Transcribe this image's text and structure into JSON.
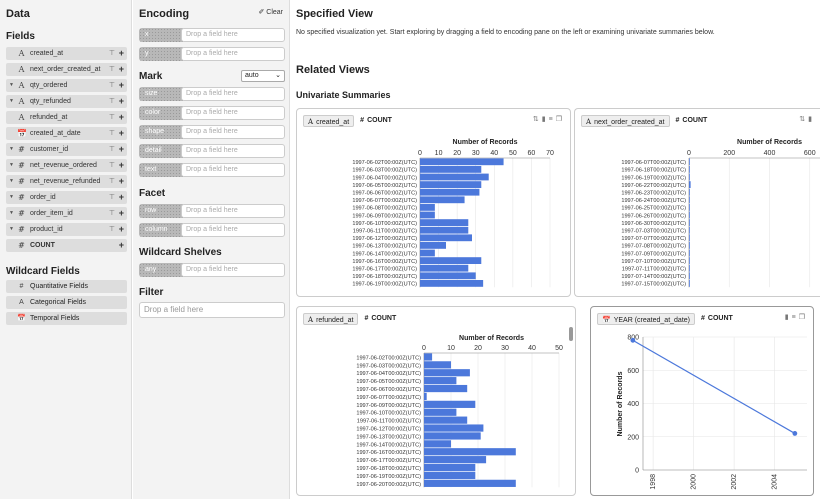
{
  "data_pane": {
    "title": "Data",
    "fields_title": "Fields",
    "fields": [
      {
        "name": "created_at",
        "type": "A",
        "caret": ""
      },
      {
        "name": "next_order_created_at",
        "type": "A",
        "caret": ""
      },
      {
        "name": "qty_ordered",
        "type": "A",
        "caret": "▼"
      },
      {
        "name": "qty_refunded",
        "type": "A",
        "caret": "▼"
      },
      {
        "name": "refunded_at",
        "type": "A",
        "caret": ""
      },
      {
        "name": "created_at_date",
        "type": "📅",
        "caret": ""
      },
      {
        "name": "customer_id",
        "type": "#",
        "caret": "▼"
      },
      {
        "name": "net_revenue_ordered",
        "type": "#",
        "caret": "▼"
      },
      {
        "name": "net_revenue_refunded",
        "type": "#",
        "caret": "▼"
      },
      {
        "name": "order_id",
        "type": "#",
        "caret": "▼"
      },
      {
        "name": "order_item_id",
        "type": "#",
        "caret": "▼"
      },
      {
        "name": "product_id",
        "type": "#",
        "caret": "▼"
      },
      {
        "name": "COUNT",
        "type": "#",
        "caret": ""
      }
    ],
    "wildcard_title": "Wildcard Fields",
    "wildcards": [
      {
        "name": "Quantitative Fields",
        "type": "#"
      },
      {
        "name": "Categorical Fields",
        "type": "A"
      },
      {
        "name": "Temporal Fields",
        "type": "📅"
      }
    ]
  },
  "encoding_pane": {
    "title": "Encoding",
    "clear_label": "Clear",
    "drop_placeholder": "Drop a field here",
    "position_shelves": [
      "x",
      "y"
    ],
    "mark_title": "Mark",
    "mark_value": "auto",
    "mark_shelves": [
      "size",
      "color",
      "shape",
      "detail",
      "text"
    ],
    "facet_title": "Facet",
    "facet_shelves": [
      "row",
      "column"
    ],
    "wildcard_title": "Wildcard Shelves",
    "wildcard_shelves": [
      "any"
    ],
    "filter_title": "Filter",
    "filter_placeholder": "Drop a field here"
  },
  "main": {
    "specified_title": "Specified View",
    "specified_info": "No specified visualization yet. Start exploring by dragging a field to encoding pane on the left or examining univariate summaries below.",
    "related_title": "Related Views",
    "univariate_title": "Univariate Summaries"
  },
  "cards": [
    {
      "field_type": "A",
      "field": "created_at",
      "count_label": "COUNT"
    },
    {
      "field_type": "A",
      "field": "next_order_created_at",
      "count_label": "COUNT"
    },
    {
      "field_type": "A",
      "field": "refunded_at",
      "count_label": "COUNT"
    },
    {
      "field_type": "📅",
      "field": "YEAR (created_at_date)",
      "count_label": "COUNT"
    }
  ],
  "chart_data": [
    {
      "type": "bar",
      "orientation": "horizontal",
      "title": "Number of Records",
      "xlim": [
        0,
        70
      ],
      "xticks": [
        0,
        10,
        20,
        30,
        40,
        50,
        60,
        70
      ],
      "bar_color": "#4c78db",
      "categories": [
        "1997-06-02T00:00Z(UTC)",
        "1997-06-03T00:00Z(UTC)",
        "1997-06-04T00:00Z(UTC)",
        "1997-06-05T00:00Z(UTC)",
        "1997-06-06T00:00Z(UTC)",
        "1997-06-07T00:00Z(UTC)",
        "1997-06-08T00:00Z(UTC)",
        "1997-06-09T00:00Z(UTC)",
        "1997-06-10T00:00Z(UTC)",
        "1997-06-11T00:00Z(UTC)",
        "1997-06-12T00:00Z(UTC)",
        "1997-06-13T00:00Z(UTC)",
        "1997-06-14T00:00Z(UTC)",
        "1997-06-16T00:00Z(UTC)",
        "1997-06-17T00:00Z(UTC)",
        "1997-06-18T00:00Z(UTC)",
        "1997-06-19T00:00Z(UTC)"
      ],
      "values": [
        45,
        33,
        37,
        33,
        32,
        24,
        8,
        8,
        26,
        26,
        28,
        14,
        8,
        33,
        26,
        30,
        34
      ]
    },
    {
      "type": "bar",
      "orientation": "horizontal",
      "title": "Number of Records",
      "xlim": [
        0,
        800
      ],
      "xticks": [
        0,
        200,
        400,
        600
      ],
      "bar_color": "#4c78db",
      "categories": [
        "1997-06-07T00:00Z(UTC)",
        "1997-06-18T00:00Z(UTC)",
        "1997-06-19T00:00Z(UTC)",
        "1997-06-22T00:00Z(UTC)",
        "1997-06-23T00:00Z(UTC)",
        "1997-06-24T00:00Z(UTC)",
        "1997-06-25T00:00Z(UTC)",
        "1997-06-26T00:00Z(UTC)",
        "1997-06-30T00:00Z(UTC)",
        "1997-07-03T00:00Z(UTC)",
        "1997-07-07T00:00Z(UTC)",
        "1997-07-08T00:00Z(UTC)",
        "1997-07-09T00:00Z(UTC)",
        "1997-07-10T00:00Z(UTC)",
        "1997-07-11T00:00Z(UTC)",
        "1997-07-14T00:00Z(UTC)",
        "1997-07-15T00:00Z(UTC)"
      ],
      "values": [
        2,
        2,
        2,
        8,
        3,
        2,
        2,
        2,
        2,
        2,
        3,
        2,
        2,
        2,
        2,
        2,
        2
      ]
    },
    {
      "type": "bar",
      "orientation": "horizontal",
      "title": "Number of Records",
      "xlim": [
        0,
        50
      ],
      "xticks": [
        0,
        10,
        20,
        30,
        40,
        50
      ],
      "bar_color": "#4c78db",
      "categories": [
        "1997-06-02T00:00Z(UTC)",
        "1997-06-03T00:00Z(UTC)",
        "1997-06-04T00:00Z(UTC)",
        "1997-06-05T00:00Z(UTC)",
        "1997-06-06T00:00Z(UTC)",
        "1997-06-07T00:00Z(UTC)",
        "1997-06-09T00:00Z(UTC)",
        "1997-06-10T00:00Z(UTC)",
        "1997-06-11T00:00Z(UTC)",
        "1997-06-12T00:00Z(UTC)",
        "1997-06-13T00:00Z(UTC)",
        "1997-06-14T00:00Z(UTC)",
        "1997-06-16T00:00Z(UTC)",
        "1997-06-17T00:00Z(UTC)",
        "1997-06-18T00:00Z(UTC)",
        "1997-06-19T00:00Z(UTC)",
        "1997-06-20T00:00Z(UTC)"
      ],
      "values": [
        3,
        10,
        17,
        12,
        16,
        1,
        19,
        12,
        16,
        22,
        21,
        10,
        34,
        23,
        19,
        19,
        34
      ]
    },
    {
      "type": "line",
      "ylabel": "Number of Records",
      "ylim": [
        0,
        800
      ],
      "yticks": [
        0,
        200,
        400,
        600,
        800
      ],
      "xlim": [
        1997.5,
        2005.6
      ],
      "xticks": [
        "1998",
        "2000",
        "2002",
        "2004"
      ],
      "line_color": "#4c78db",
      "points": [
        {
          "x": 1997,
          "y": 780
        },
        {
          "x": 2005,
          "y": 220
        }
      ]
    }
  ]
}
